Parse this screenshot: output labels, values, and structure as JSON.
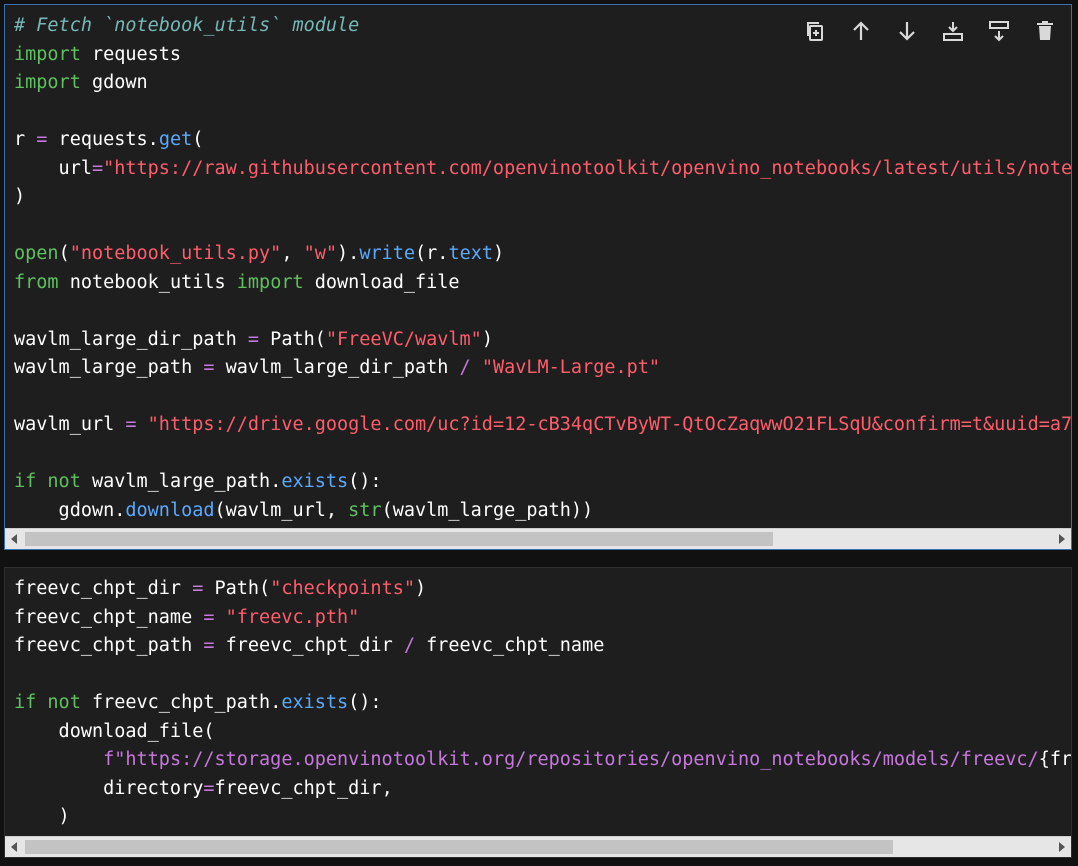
{
  "cell1": {
    "lines": [
      [
        {
          "t": "# Fetch `notebook_utils` module",
          "c": "c"
        }
      ],
      [
        {
          "t": "import",
          "c": "k"
        },
        {
          "t": " requests",
          "c": "w"
        }
      ],
      [
        {
          "t": "import",
          "c": "k"
        },
        {
          "t": " gdown",
          "c": "w"
        }
      ],
      [],
      [
        {
          "t": "r ",
          "c": "w"
        },
        {
          "t": "=",
          "c": "o"
        },
        {
          "t": " requests.",
          "c": "w"
        },
        {
          "t": "get",
          "c": "f"
        },
        {
          "t": "(",
          "c": "w"
        }
      ],
      [
        {
          "t": "    url",
          "c": "w"
        },
        {
          "t": "=",
          "c": "o"
        },
        {
          "t": "\"https://raw.githubusercontent.com/openvinotoolkit/openvino_notebooks/latest/utils/note",
          "c": "s"
        }
      ],
      [
        {
          "t": ")",
          "c": "w"
        }
      ],
      [],
      [
        {
          "t": "open",
          "c": "b"
        },
        {
          "t": "(",
          "c": "w"
        },
        {
          "t": "\"notebook_utils.py\"",
          "c": "s"
        },
        {
          "t": ", ",
          "c": "w"
        },
        {
          "t": "\"w\"",
          "c": "s"
        },
        {
          "t": ").",
          "c": "w"
        },
        {
          "t": "write",
          "c": "f"
        },
        {
          "t": "(r.",
          "c": "w"
        },
        {
          "t": "text",
          "c": "f"
        },
        {
          "t": ")",
          "c": "w"
        }
      ],
      [
        {
          "t": "from",
          "c": "k"
        },
        {
          "t": " notebook_utils ",
          "c": "w"
        },
        {
          "t": "import",
          "c": "k"
        },
        {
          "t": " download_file",
          "c": "w"
        }
      ],
      [],
      [
        {
          "t": "wavlm_large_dir_path ",
          "c": "w"
        },
        {
          "t": "=",
          "c": "o"
        },
        {
          "t": " Path(",
          "c": "w"
        },
        {
          "t": "\"FreeVC/wavlm\"",
          "c": "s"
        },
        {
          "t": ")",
          "c": "w"
        }
      ],
      [
        {
          "t": "wavlm_large_path ",
          "c": "w"
        },
        {
          "t": "=",
          "c": "o"
        },
        {
          "t": " wavlm_large_dir_path ",
          "c": "w"
        },
        {
          "t": "/",
          "c": "o"
        },
        {
          "t": " ",
          "c": "w"
        },
        {
          "t": "\"WavLM-Large.pt\"",
          "c": "s"
        }
      ],
      [],
      [
        {
          "t": "wavlm_url ",
          "c": "w"
        },
        {
          "t": "=",
          "c": "o"
        },
        {
          "t": " ",
          "c": "w"
        },
        {
          "t": "\"https://drive.google.com/uc?id=12-cB34qCTvByWT-QtOcZaqwwO21FLSqU&confirm=t&uuid=a7",
          "c": "s"
        }
      ],
      [],
      [
        {
          "t": "if",
          "c": "k"
        },
        {
          "t": " ",
          "c": "w"
        },
        {
          "t": "not",
          "c": "k"
        },
        {
          "t": " wavlm_large_path.",
          "c": "w"
        },
        {
          "t": "exists",
          "c": "f"
        },
        {
          "t": "():",
          "c": "w"
        }
      ],
      [
        {
          "t": "    gdown.",
          "c": "w"
        },
        {
          "t": "download",
          "c": "f"
        },
        {
          "t": "(wavlm_url, ",
          "c": "w"
        },
        {
          "t": "str",
          "c": "b"
        },
        {
          "t": "(wavlm_large_path))",
          "c": "w"
        }
      ]
    ]
  },
  "cell2": {
    "lines": [
      [
        {
          "t": "freevc_chpt_dir ",
          "c": "w"
        },
        {
          "t": "=",
          "c": "o"
        },
        {
          "t": " Path(",
          "c": "w"
        },
        {
          "t": "\"checkpoints\"",
          "c": "s"
        },
        {
          "t": ")",
          "c": "w"
        }
      ],
      [
        {
          "t": "freevc_chpt_name ",
          "c": "w"
        },
        {
          "t": "=",
          "c": "o"
        },
        {
          "t": " ",
          "c": "w"
        },
        {
          "t": "\"freevc.pth\"",
          "c": "s"
        }
      ],
      [
        {
          "t": "freevc_chpt_path ",
          "c": "w"
        },
        {
          "t": "=",
          "c": "o"
        },
        {
          "t": " freevc_chpt_dir ",
          "c": "w"
        },
        {
          "t": "/",
          "c": "o"
        },
        {
          "t": " freevc_chpt_name",
          "c": "w"
        }
      ],
      [],
      [
        {
          "t": "if",
          "c": "k"
        },
        {
          "t": " ",
          "c": "w"
        },
        {
          "t": "not",
          "c": "k"
        },
        {
          "t": " freevc_chpt_path.",
          "c": "w"
        },
        {
          "t": "exists",
          "c": "f"
        },
        {
          "t": "():",
          "c": "w"
        }
      ],
      [
        {
          "t": "    download_file(",
          "c": "w"
        }
      ],
      [
        {
          "t": "        ",
          "c": "w"
        },
        {
          "t": "f",
          "c": "fs"
        },
        {
          "t": "\"https://storage.openvinotoolkit.org/repositories/openvino_notebooks/models/freevc/",
          "c": "fs"
        },
        {
          "t": "{fr",
          "c": "w"
        }
      ],
      [
        {
          "t": "        directory",
          "c": "w"
        },
        {
          "t": "=",
          "c": "o"
        },
        {
          "t": "freevc_chpt_dir,",
          "c": "w"
        }
      ],
      [
        {
          "t": "    )",
          "c": "w"
        }
      ]
    ]
  },
  "toolbar": {
    "icons": [
      "duplicate-icon",
      "move-up-icon",
      "move-down-icon",
      "insert-above-icon",
      "insert-below-icon",
      "delete-icon"
    ]
  },
  "colors": {
    "background": "#1e1e1e",
    "comment": "#76b8b5",
    "keyword": "#5fc05f",
    "string": "#ff5c6c",
    "function": "#5aa9ff",
    "operator": "#c678dd",
    "selection_border": "#3a6fb0"
  }
}
